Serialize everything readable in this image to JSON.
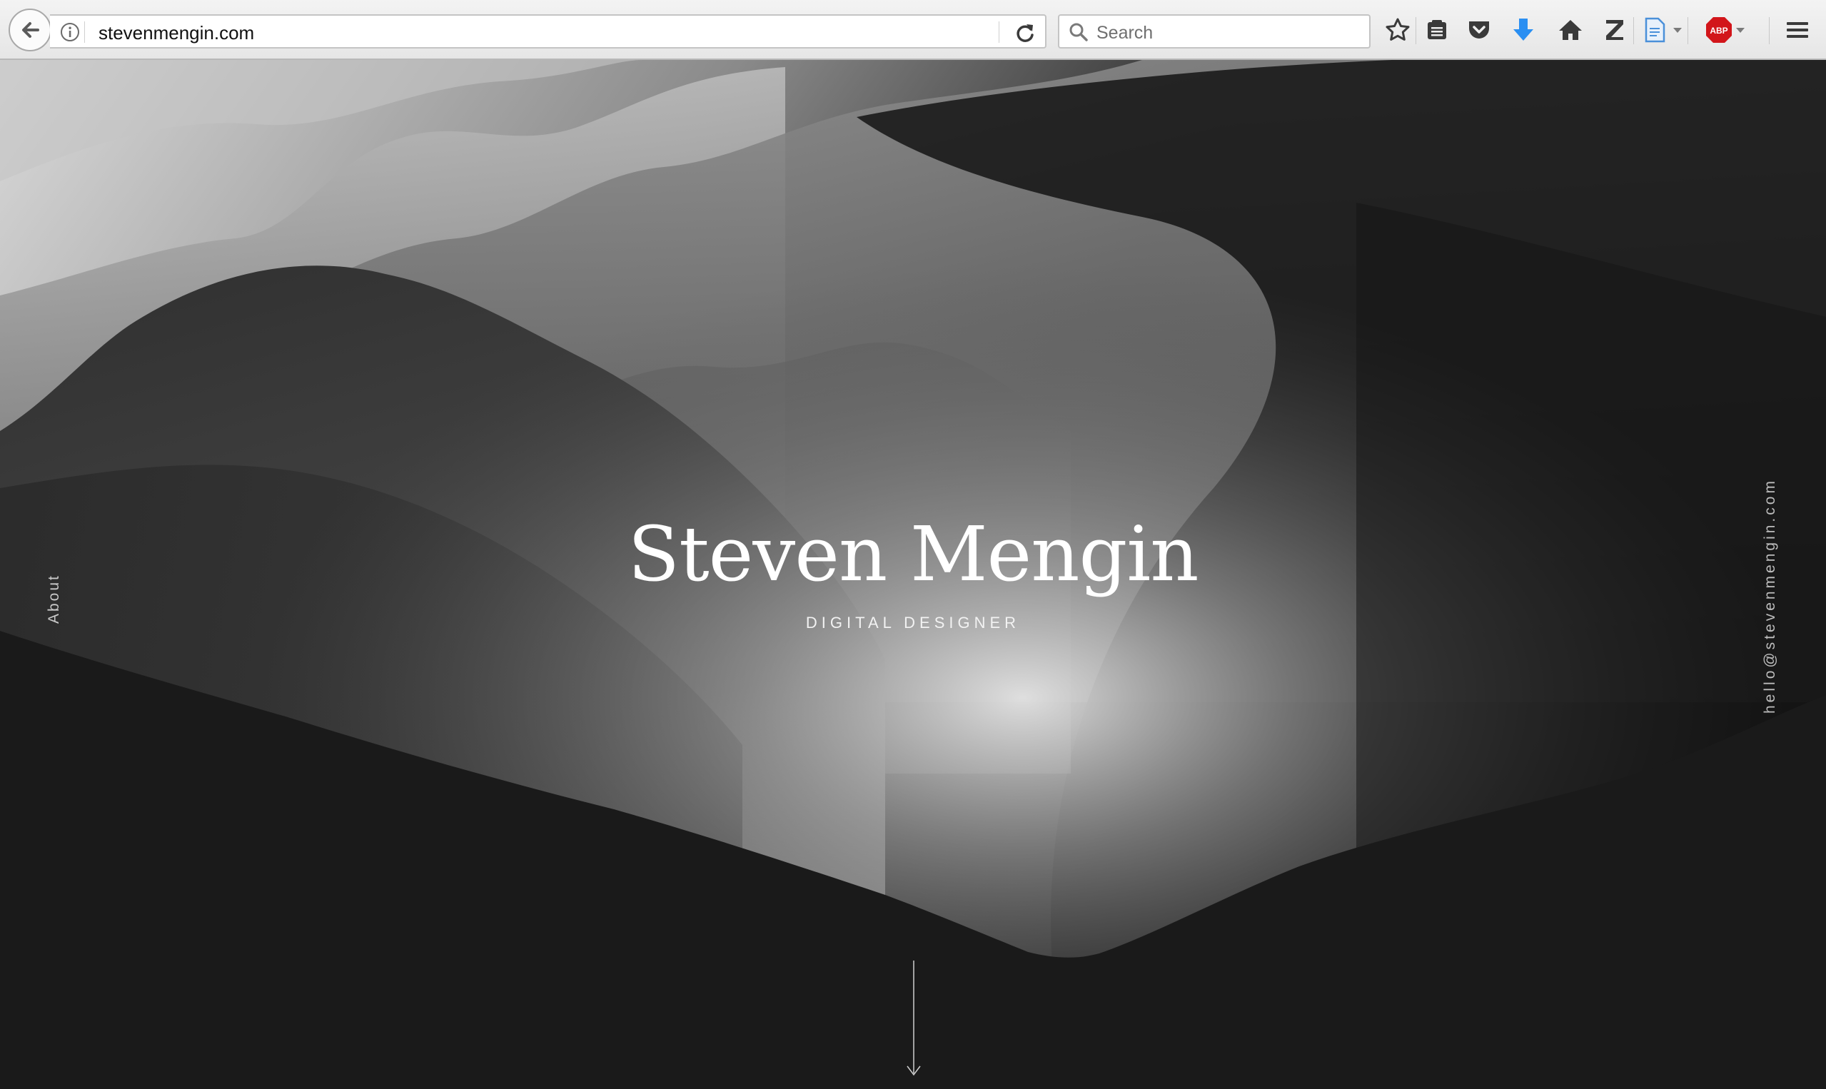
{
  "browser": {
    "url": "stevenmengin.com",
    "search_placeholder": "Search",
    "adblock_badge": "ABP",
    "toolbar_icons": [
      "back-icon",
      "info-icon",
      "reload-icon",
      "search-icon",
      "bookmark-star-icon",
      "reading-list-icon",
      "pocket-icon",
      "download-icon",
      "home-icon",
      "zotero-icon",
      "document-icon",
      "adblock-icon",
      "hamburger-menu-icon"
    ],
    "accent_download": "#2a8ff2",
    "accent_adblock": "#d2151a"
  },
  "page": {
    "title": "Steven Mengin",
    "subtitle": "DIGITAL DESIGNER",
    "side_left_link": "About",
    "side_right_link": "hello@stevenmengin.com",
    "scroll_icon": "arrow-down-icon",
    "background_color": "#1a1a1a"
  }
}
